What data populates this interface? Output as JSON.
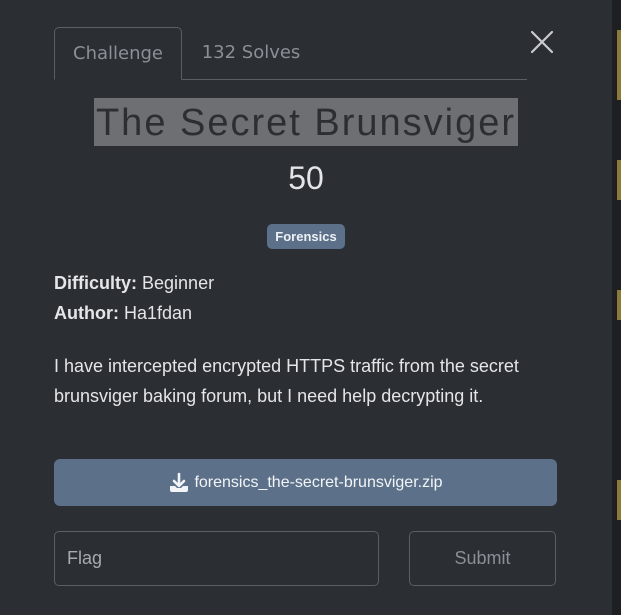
{
  "tabs": [
    {
      "label": "Challenge",
      "active": true
    },
    {
      "label": "132 Solves",
      "active": false
    }
  ],
  "challenge": {
    "title": "The Secret Brunsviger",
    "points": "50",
    "category": "Forensics",
    "difficulty_label": "Difficulty:",
    "difficulty_value": "Beginner",
    "author_label": "Author:",
    "author_value": "Ha1fdan",
    "description": "I have intercepted encrypted HTTPS traffic from the secret brunsviger baking forum, but I need help decrypting it.",
    "file_name": "forensics_the-secret-brunsviger.zip"
  },
  "form": {
    "flag_placeholder": "Flag",
    "flag_value": "",
    "submit_label": "Submit"
  },
  "icons": {
    "close": "close-icon",
    "download": "download-icon"
  },
  "colors": {
    "background": "#2b2e33",
    "accent": "#5c7189",
    "text": "#e4e5e7",
    "muted": "#8b8f96"
  }
}
